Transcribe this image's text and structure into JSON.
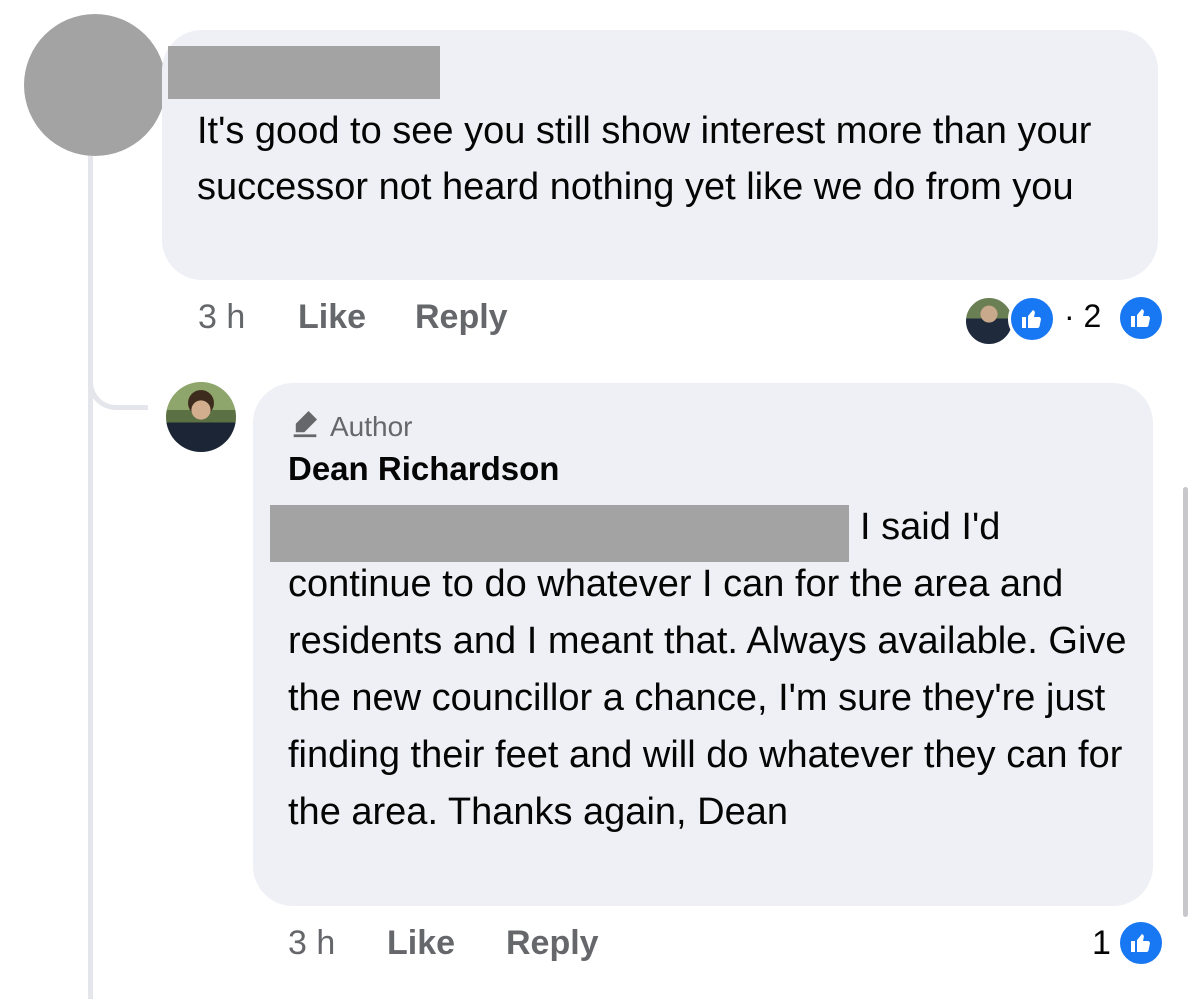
{
  "comments": [
    {
      "author_redacted": true,
      "text": "It's good to see you still show interest more than your successor not heard nothing yet like we do from you",
      "time": "3 h",
      "like_label": "Like",
      "reply_label": "Reply",
      "reactions_summary": "· 2"
    }
  ],
  "reply": {
    "badge": "Author",
    "author": "Dean Richardson",
    "text_after_mention": "I said I'd continue to do whatever I can for the area and residents and I meant that. Always available. Give the new councillor a chance, I'm sure they're just finding their feet and will do whatever they can for the area. Thanks again, Dean",
    "time": "3 h",
    "like_label": "Like",
    "reply_label": "Reply",
    "reaction_count": "1"
  },
  "colors": {
    "bubble": "#eff0f5",
    "like_blue": "#1877f2",
    "meta_gray": "#65676b",
    "redaction": "#a3a3a3"
  },
  "icons": [
    "like-icon",
    "pen-icon"
  ]
}
